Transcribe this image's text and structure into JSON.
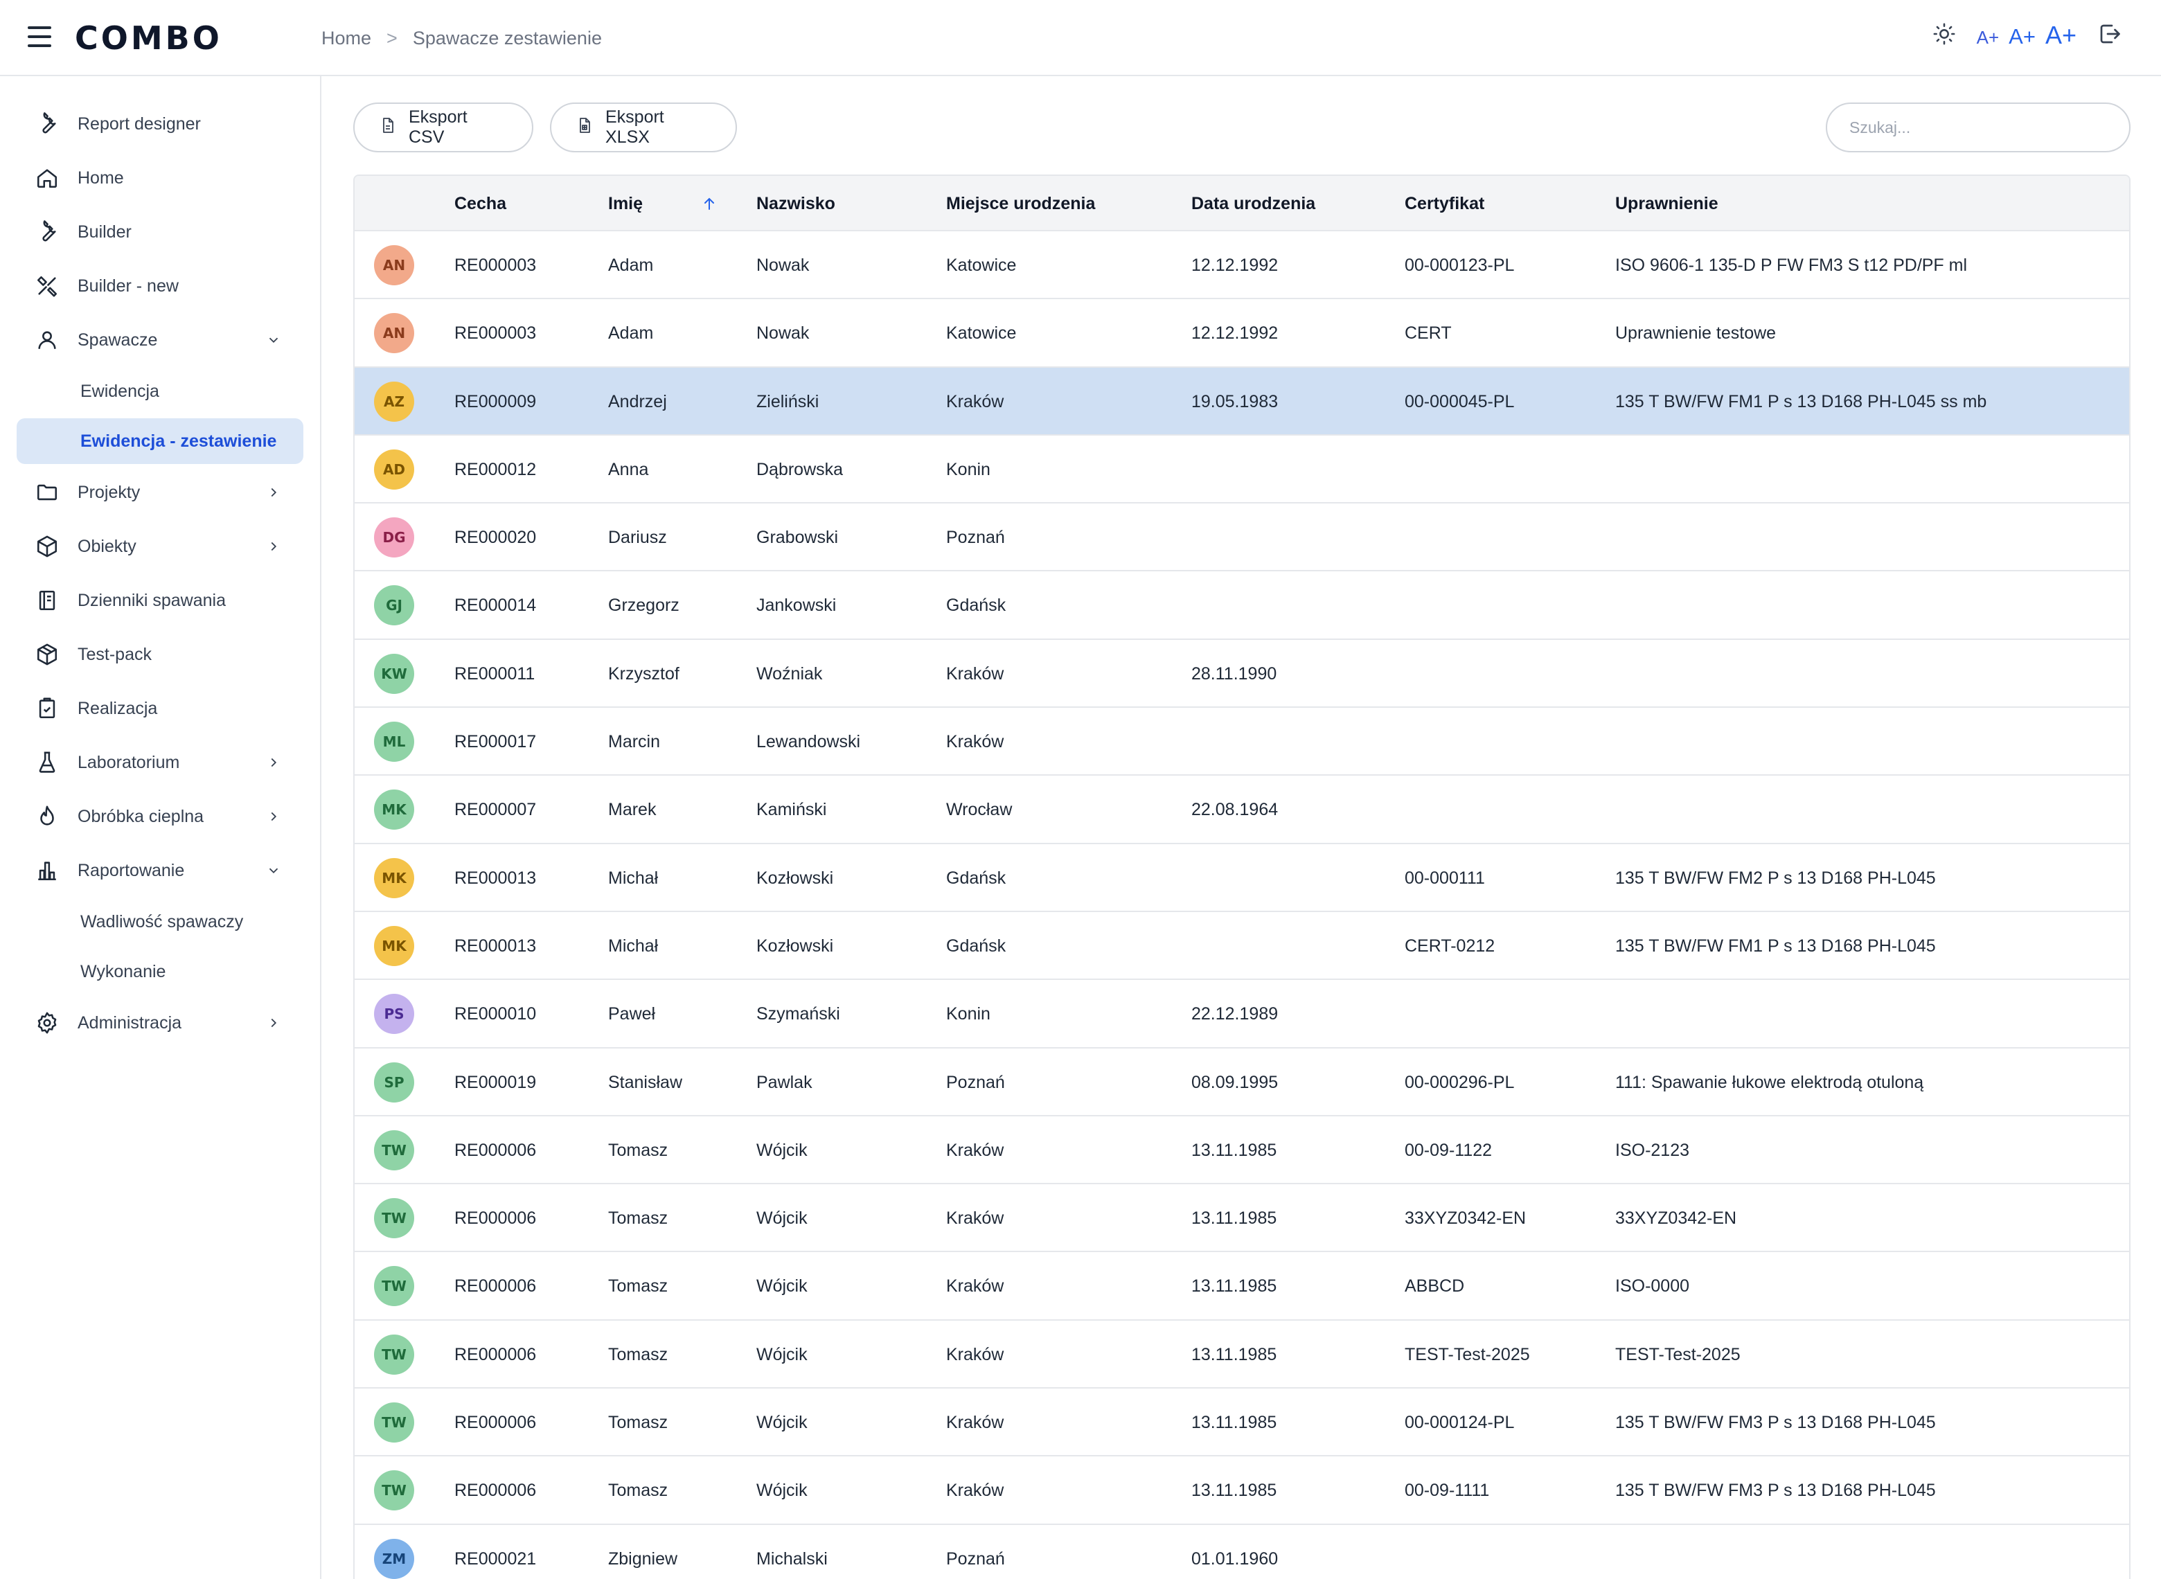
{
  "header": {
    "brand": "COMBO",
    "breadcrumb": [
      "Home",
      "Spawacze zestawienie"
    ],
    "breadcrumb_sep": ">",
    "font_sizes": [
      "A+",
      "A+",
      "A+"
    ]
  },
  "sidebar": {
    "items": [
      {
        "label": "Report designer",
        "icon": "wrench-icon"
      },
      {
        "label": "Home",
        "icon": "home-icon"
      },
      {
        "label": "Builder",
        "icon": "wrench-icon"
      },
      {
        "label": "Builder - new",
        "icon": "tools-icon"
      },
      {
        "label": "Spawacze",
        "icon": "user-icon",
        "expanded": true
      },
      {
        "label": "Ewidencja"
      },
      {
        "label": "Ewidencja - zestawienie",
        "active": true
      },
      {
        "label": "Projekty",
        "icon": "folder-icon"
      },
      {
        "label": "Obiekty",
        "icon": "cube-icon"
      },
      {
        "label": "Dzienniki spawania",
        "icon": "journal-icon"
      },
      {
        "label": "Test-pack",
        "icon": "package-icon"
      },
      {
        "label": "Realizacja",
        "icon": "clipboard-check-icon"
      },
      {
        "label": "Laboratorium",
        "icon": "flask-icon"
      },
      {
        "label": "Obróbka cieplna",
        "icon": "flame-icon"
      },
      {
        "label": "Raportowanie",
        "icon": "bar-chart-icon",
        "expanded": true
      },
      {
        "label": "Wadliwość spawaczy"
      },
      {
        "label": "Wykonanie"
      },
      {
        "label": "Administracja",
        "icon": "gear-icon"
      }
    ]
  },
  "toolbar": {
    "export_csv": "Eksport CSV",
    "export_xlsx": "Eksport XLSX",
    "search_placeholder": "Szukaj..."
  },
  "table": {
    "columns": [
      "Cecha",
      "Imię",
      "Nazwisko",
      "Miejsce urodzenia",
      "Data urodzenia",
      "Certyfikat",
      "Uprawnienie"
    ],
    "sorted_column": "Imię",
    "sort_direction": "asc",
    "rows": [
      {
        "initials": "AN",
        "color": "#f2a98a",
        "text": "#8a3b1c",
        "cecha": "RE000003",
        "imie": "Adam",
        "nazwisko": "Nowak",
        "miejsce": "Katowice",
        "data": "12.12.1992",
        "cert": "00-000123-PL",
        "upr": "ISO 9606-1 135-D P FW FM3 S t12 PD/PF ml"
      },
      {
        "initials": "AN",
        "color": "#f2a98a",
        "text": "#8a3b1c",
        "cecha": "RE000003",
        "imie": "Adam",
        "nazwisko": "Nowak",
        "miejsce": "Katowice",
        "data": "12.12.1992",
        "cert": "CERT",
        "upr": "Uprawnienie testowe"
      },
      {
        "initials": "AZ",
        "color": "#f4c34a",
        "text": "#7a5400",
        "cecha": "RE000009",
        "imie": "Andrzej",
        "nazwisko": "Zieliński",
        "miejsce": "Kraków",
        "data": "19.05.1983",
        "cert": "00-000045-PL",
        "upr": "135 T BW/FW FM1 P s 13 D168 PH-L045 ss mb",
        "selected": true
      },
      {
        "initials": "AD",
        "color": "#f4c34a",
        "text": "#7a5400",
        "cecha": "RE000012",
        "imie": "Anna",
        "nazwisko": "Dąbrowska",
        "miejsce": "Konin",
        "data": "",
        "cert": "",
        "upr": ""
      },
      {
        "initials": "DG",
        "color": "#f4a6c0",
        "text": "#8a1f48",
        "cecha": "RE000020",
        "imie": "Dariusz",
        "nazwisko": "Grabowski",
        "miejsce": "Poznań",
        "data": "",
        "cert": "",
        "upr": ""
      },
      {
        "initials": "GJ",
        "color": "#8fd3a6",
        "text": "#1f6b3b",
        "cecha": "RE000014",
        "imie": "Grzegorz",
        "nazwisko": "Jankowski",
        "miejsce": "Gdańsk",
        "data": "",
        "cert": "",
        "upr": ""
      },
      {
        "initials": "KW",
        "color": "#8fd3a6",
        "text": "#1f6b3b",
        "cecha": "RE000011",
        "imie": "Krzysztof",
        "nazwisko": "Woźniak",
        "miejsce": "Kraków",
        "data": "28.11.1990",
        "cert": "",
        "upr": ""
      },
      {
        "initials": "ML",
        "color": "#8fd3a6",
        "text": "#1f6b3b",
        "cecha": "RE000017",
        "imie": "Marcin",
        "nazwisko": "Lewandowski",
        "miejsce": "Kraków",
        "data": "",
        "cert": "",
        "upr": ""
      },
      {
        "initials": "MK",
        "color": "#8fd3a6",
        "text": "#1f6b3b",
        "cecha": "RE000007",
        "imie": "Marek",
        "nazwisko": "Kamiński",
        "miejsce": "Wrocław",
        "data": "22.08.1964",
        "cert": "",
        "upr": ""
      },
      {
        "initials": "MK",
        "color": "#f4c34a",
        "text": "#7a5400",
        "cecha": "RE000013",
        "imie": "Michał",
        "nazwisko": "Kozłowski",
        "miejsce": "Gdańsk",
        "data": "",
        "cert": "00-000111",
        "upr": "135 T BW/FW FM2 P s 13 D168 PH-L045"
      },
      {
        "initials": "MK",
        "color": "#f4c34a",
        "text": "#7a5400",
        "cecha": "RE000013",
        "imie": "Michał",
        "nazwisko": "Kozłowski",
        "miejsce": "Gdańsk",
        "data": "",
        "cert": "CERT-0212",
        "upr": "135 T BW/FW FM1 P s 13 D168 PH-L045"
      },
      {
        "initials": "PS",
        "color": "#c4b2ee",
        "text": "#4b2b93",
        "cecha": "RE000010",
        "imie": "Paweł",
        "nazwisko": "Szymański",
        "miejsce": "Konin",
        "data": "22.12.1989",
        "cert": "",
        "upr": ""
      },
      {
        "initials": "SP",
        "color": "#8fd3a6",
        "text": "#1f6b3b",
        "cecha": "RE000019",
        "imie": "Stanisław",
        "nazwisko": "Pawlak",
        "miejsce": "Poznań",
        "data": "08.09.1995",
        "cert": "00-000296-PL",
        "upr": "111: Spawanie łukowe elektrodą otuloną"
      },
      {
        "initials": "TW",
        "color": "#8fd3a6",
        "text": "#1f6b3b",
        "cecha": "RE000006",
        "imie": "Tomasz",
        "nazwisko": "Wójcik",
        "miejsce": "Kraków",
        "data": "13.11.1985",
        "cert": "00-09-1122",
        "upr": "ISO-2123"
      },
      {
        "initials": "TW",
        "color": "#8fd3a6",
        "text": "#1f6b3b",
        "cecha": "RE000006",
        "imie": "Tomasz",
        "nazwisko": "Wójcik",
        "miejsce": "Kraków",
        "data": "13.11.1985",
        "cert": "33XYZ0342-EN",
        "upr": "33XYZ0342-EN"
      },
      {
        "initials": "TW",
        "color": "#8fd3a6",
        "text": "#1f6b3b",
        "cecha": "RE000006",
        "imie": "Tomasz",
        "nazwisko": "Wójcik",
        "miejsce": "Kraków",
        "data": "13.11.1985",
        "cert": "ABBCD",
        "upr": "ISO-0000"
      },
      {
        "initials": "TW",
        "color": "#8fd3a6",
        "text": "#1f6b3b",
        "cecha": "RE000006",
        "imie": "Tomasz",
        "nazwisko": "Wójcik",
        "miejsce": "Kraków",
        "data": "13.11.1985",
        "cert": "TEST-Test-2025",
        "upr": "TEST-Test-2025"
      },
      {
        "initials": "TW",
        "color": "#8fd3a6",
        "text": "#1f6b3b",
        "cecha": "RE000006",
        "imie": "Tomasz",
        "nazwisko": "Wójcik",
        "miejsce": "Kraków",
        "data": "13.11.1985",
        "cert": "00-000124-PL",
        "upr": "135 T BW/FW FM3 P s 13 D168 PH-L045"
      },
      {
        "initials": "TW",
        "color": "#8fd3a6",
        "text": "#1f6b3b",
        "cecha": "RE000006",
        "imie": "Tomasz",
        "nazwisko": "Wójcik",
        "miejsce": "Kraków",
        "data": "13.11.1985",
        "cert": "00-09-1111",
        "upr": "135 T BW/FW FM3 P s 13 D168 PH-L045"
      },
      {
        "initials": "ZM",
        "color": "#7fb2ea",
        "text": "#17457a",
        "cecha": "RE000021",
        "imie": "Zbigniew",
        "nazwisko": "Michalski",
        "miejsce": "Poznań",
        "data": "01.01.1960",
        "cert": "",
        "upr": ""
      }
    ]
  }
}
